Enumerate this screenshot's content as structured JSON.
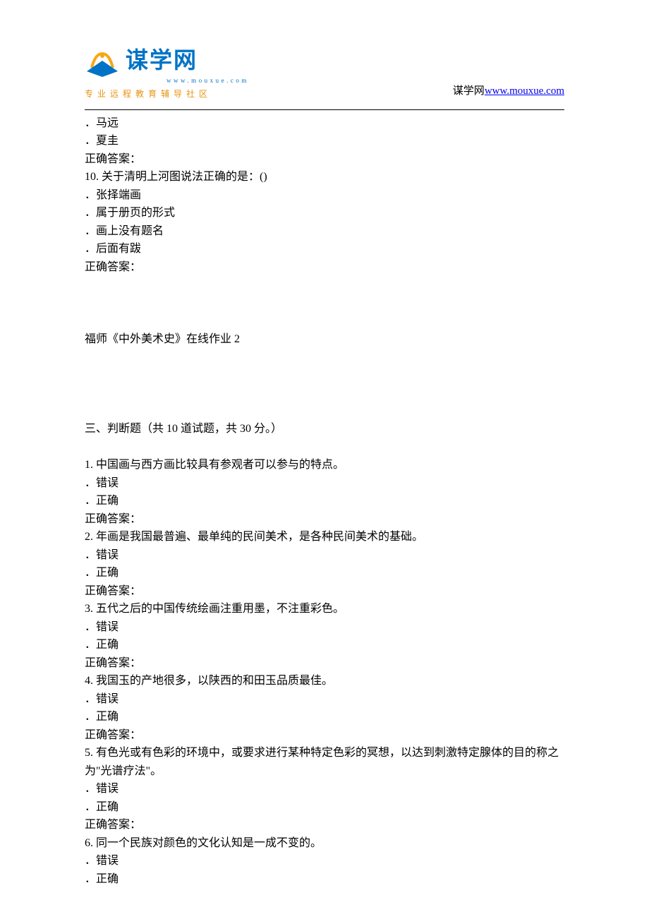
{
  "header": {
    "logo_text": "谋学网",
    "logo_url": "www.mouxue.com",
    "tagline": "专业远程教育辅导社区",
    "site_label": "谋学网",
    "site_link": "www.mouxue.com"
  },
  "prior_options": [
    "．马远",
    "．夏圭",
    "正确答案："
  ],
  "q10": {
    "prompt": "10.   关于清明上河图说法正确的是：()",
    "opts": [
      "．张择端画",
      "．属于册页的形式",
      "．画上没有题名",
      "．后面有跋"
    ],
    "answer_label": "正确答案："
  },
  "assignment_title": "福师《中外美术史》在线作业 2",
  "section3_title": "三、判断题（共 10 道试题，共 30 分。）",
  "tf": [
    {
      "prompt": "1.   中国画与西方画比较具有参观者可以参与的特点。",
      "opts": [
        "．错误",
        "．正确"
      ],
      "answer_label": "正确答案："
    },
    {
      "prompt": "2.   年画是我国最普遍、最单纯的民间美术，是各种民间美术的基础。",
      "opts": [
        "．错误",
        "．正确"
      ],
      "answer_label": "正确答案："
    },
    {
      "prompt": "3.   五代之后的中国传统绘画注重用墨，不注重彩色。",
      "opts": [
        "．错误",
        "．正确"
      ],
      "answer_label": "正确答案："
    },
    {
      "prompt": "4.   我国玉的产地很多，以陕西的和田玉品质最佳。",
      "opts": [
        "．错误",
        "．正确"
      ],
      "answer_label": "正确答案："
    },
    {
      "prompt": "5.   有色光或有色彩的环境中，或要求进行某种特定色彩的冥想，以达到刺激特定腺体的目的称之为\"光谱疗法\"。",
      "opts": [
        "．错误",
        "．正确"
      ],
      "answer_label": "正确答案："
    },
    {
      "prompt": "6.   同一个民族对颜色的文化认知是一成不变的。",
      "opts": [
        "．错误",
        "．正确"
      ]
    }
  ]
}
